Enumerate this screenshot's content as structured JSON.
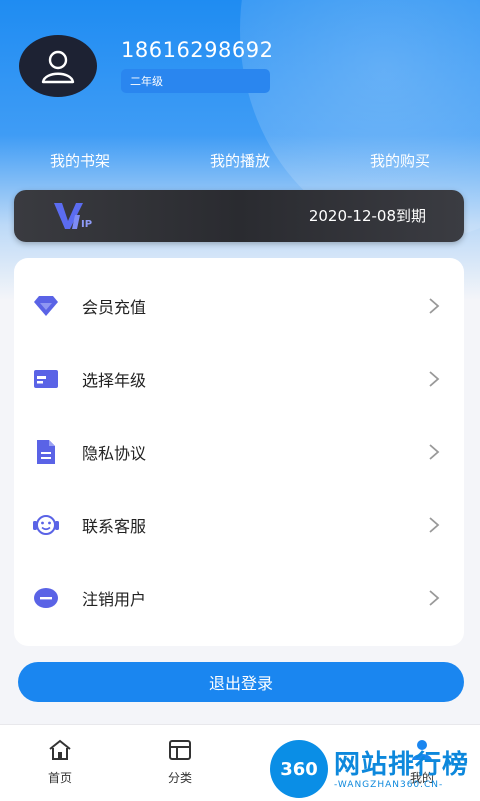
{
  "profile": {
    "phone": "18616298692",
    "grade": "二年级"
  },
  "shortcuts": [
    {
      "label": "我的书架"
    },
    {
      "label": "我的播放"
    },
    {
      "label": "我的购买"
    }
  ],
  "vip": {
    "logo_text": "VIP",
    "expire_text": "2020-12-08到期"
  },
  "menu": {
    "items": [
      {
        "label": "会员充值",
        "icon": "diamond-icon"
      },
      {
        "label": "选择年级",
        "icon": "card-icon"
      },
      {
        "label": "隐私协议",
        "icon": "document-icon"
      },
      {
        "label": "联系客服",
        "icon": "headset-icon"
      },
      {
        "label": "注销用户",
        "icon": "minus-circle-icon"
      }
    ]
  },
  "logout_label": "退出登录",
  "tabbar": {
    "items": [
      {
        "label": "首页",
        "icon": "home-icon"
      },
      {
        "label": "分类",
        "icon": "category-icon"
      },
      {
        "label": "我的",
        "icon": "user-icon"
      }
    ]
  },
  "watermark": {
    "badge": "360",
    "title": "网站排行榜",
    "subtitle": "-WANGZHAN360.CN-"
  },
  "colors": {
    "accent": "#1a86f0",
    "menu_icon": "#5a63e6",
    "vip_card": "#2f3035"
  }
}
